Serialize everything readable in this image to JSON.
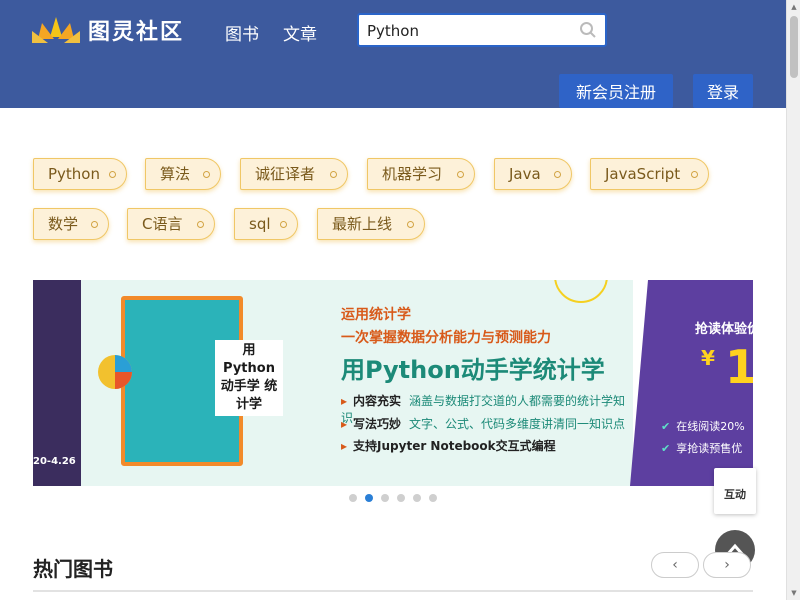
{
  "header": {
    "logo_text": "图灵社区",
    "nav": [
      "图书",
      "文章"
    ],
    "search_value": "Python",
    "register_label": "新会员注册",
    "login_label": "登录",
    "colors": {
      "header_bg": "#3d5a9e",
      "button_bg": "#2f63c7"
    }
  },
  "tags": [
    "Python",
    "算法",
    "诚征译者",
    "机器学习",
    "Java",
    "JavaScript",
    "数学",
    "C语言",
    "sql",
    "最新上线"
  ],
  "banner": {
    "date": "20-4.26",
    "book_title": "用Python 动手学 统计学",
    "line1": "运用统计学",
    "line2": "一次掌握数据分析能力与预测能力",
    "headline": "用Python动手学统计学",
    "features": [
      {
        "k": "内容充实",
        "v": "涵盖与数据打交道的人都需要的统计学知识"
      },
      {
        "k": "写法巧妙",
        "v": "文字、公式、代码多维度讲清同一知识点"
      },
      {
        "k": "支持Jupyter Notebook交互式编程",
        "v": ""
      }
    ],
    "promo_title": "抢读体验价",
    "promo_yen": "¥",
    "promo_num": "1",
    "promo_bullets": [
      "在线阅读20%",
      "享抢读预售优"
    ],
    "slide_count": 6,
    "active_slide": 2
  },
  "float": {
    "interact_label": "互动"
  },
  "section": {
    "title": "热门图书",
    "prev_icon": "‹",
    "next_icon": "›"
  }
}
